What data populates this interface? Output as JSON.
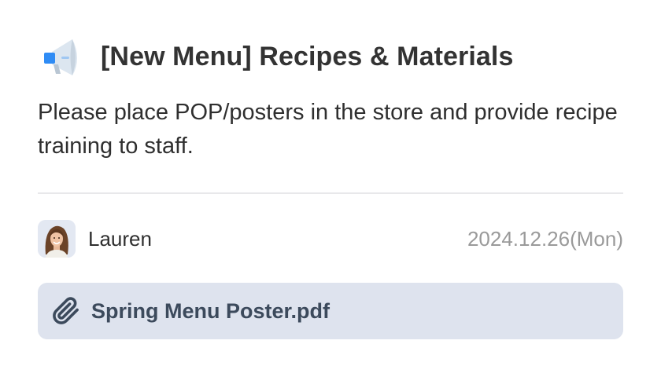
{
  "notice": {
    "icon": "megaphone-icon",
    "title": "[New Menu] Recipes & Materials",
    "description": "Please place POP/posters in the store and provide recipe training to staff."
  },
  "author": {
    "name": "Lauren",
    "avatar": "avatar-photo",
    "date": "2024.12.26(Mon)"
  },
  "attachment": {
    "icon": "paperclip-icon",
    "filename": "Spring Menu Poster.pdf"
  },
  "colors": {
    "title_text": "#333333",
    "date_text": "#9a9a9a",
    "attachment_background": "#dee3ee",
    "attachment_text": "#3c4a5c",
    "megaphone_accent": "#2f8cf5"
  }
}
